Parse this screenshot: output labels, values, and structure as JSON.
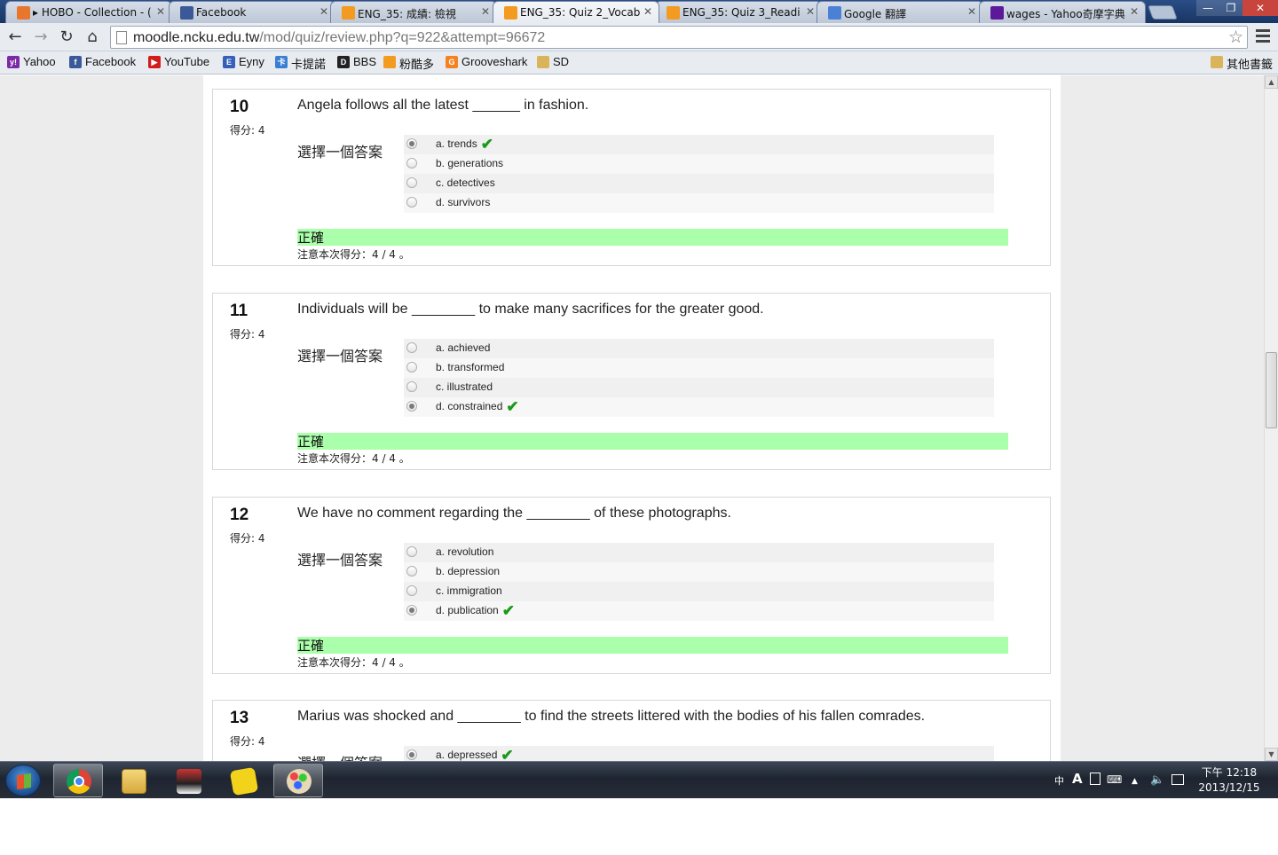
{
  "tabs": [
    {
      "label": "▸ HOBO - Collection - (",
      "favicon": "rss-icon",
      "color": "#e8772e"
    },
    {
      "label": "Facebook",
      "favicon": "facebook-icon",
      "color": "#3b5998"
    },
    {
      "label": "ENG_35: 成績: 檢視",
      "favicon": "moodle-icon",
      "color": "#f39a21"
    },
    {
      "label": "ENG_35: Quiz 2_Vocab",
      "favicon": "moodle-icon",
      "color": "#f39a21"
    },
    {
      "label": "ENG_35: Quiz 3_Readi",
      "favicon": "moodle-icon",
      "color": "#f39a21"
    },
    {
      "label": "Google 翻譯",
      "favicon": "google-translate-icon",
      "color": "#4a80d6"
    },
    {
      "label": "wages - Yahoo奇摩字典",
      "favicon": "yahoo-icon",
      "color": "#5c1a9a"
    }
  ],
  "window_controls": {
    "minimize": "—",
    "restore": "❐",
    "close": "✕"
  },
  "toolbar": {
    "url_host": "moodle.ncku.edu.tw",
    "url_path": "/mod/quiz/review.php?q=922&attempt=96672",
    "back": "←",
    "forward": "→",
    "reload": "↻",
    "home": "⌂",
    "star": "☆"
  },
  "bookmarks": [
    {
      "label": "Yahoo",
      "color": "#7b2aa6",
      "glyph": "y!"
    },
    {
      "label": "Facebook",
      "color": "#3b5998",
      "glyph": "f"
    },
    {
      "label": "YouTube",
      "color": "#d21b1b",
      "glyph": "▶"
    },
    {
      "label": "Eyny",
      "color": "#3561b8",
      "glyph": "E"
    },
    {
      "label": "卡提諾",
      "color": "#3a7fd4",
      "glyph": "卡"
    },
    {
      "label": "BBS",
      "color": "#222222",
      "glyph": "D"
    },
    {
      "label": "粉酷多",
      "color": "#f39a21",
      "glyph": " "
    },
    {
      "label": "Grooveshark",
      "color": "#f58220",
      "glyph": "G"
    },
    {
      "label": "SD",
      "color": "#d9b45a",
      "glyph": " "
    }
  ],
  "bookmarks_other": "其他書籤",
  "questions": [
    {
      "number": "10",
      "grade": "得分: 4",
      "text": "Angela follows all the latest ______ in fashion.",
      "prompt": "選擇一個答案",
      "answers": [
        {
          "label": "a. trends",
          "selected": true,
          "correct": true
        },
        {
          "label": "b. generations",
          "selected": false,
          "correct": false
        },
        {
          "label": "c. detectives",
          "selected": false,
          "correct": false
        },
        {
          "label": "d. survivors",
          "selected": false,
          "correct": false
        }
      ],
      "feedback": "正確",
      "mark": "注意本次得分：4 / 4 。"
    },
    {
      "number": "11",
      "grade": "得分: 4",
      "text": "Individuals will be ________ to make many sacrifices for the greater good.",
      "prompt": "選擇一個答案",
      "answers": [
        {
          "label": "a. achieved",
          "selected": false,
          "correct": false
        },
        {
          "label": "b. transformed",
          "selected": false,
          "correct": false
        },
        {
          "label": "c. illustrated",
          "selected": false,
          "correct": false
        },
        {
          "label": "d. constrained",
          "selected": true,
          "correct": true
        }
      ],
      "feedback": "正確",
      "mark": "注意本次得分：4 / 4 。"
    },
    {
      "number": "12",
      "grade": "得分: 4",
      "text": "We have no comment regarding the ________ of these photographs.",
      "prompt": "選擇一個答案",
      "answers": [
        {
          "label": "a. revolution",
          "selected": false,
          "correct": false
        },
        {
          "label": "b. depression",
          "selected": false,
          "correct": false
        },
        {
          "label": "c. immigration",
          "selected": false,
          "correct": false
        },
        {
          "label": "d. publication",
          "selected": true,
          "correct": true
        }
      ],
      "feedback": "正確",
      "mark": "注意本次得分：4 / 4 。"
    },
    {
      "number": "13",
      "grade": "得分: 4",
      "text": "Marius was shocked and ________ to find the streets littered with the bodies of his fallen comrades.",
      "prompt": "選擇一個答案",
      "answers": [
        {
          "label": "a. depressed",
          "selected": true,
          "correct": true
        }
      ],
      "feedback": "",
      "mark": ""
    }
  ],
  "taskbar": {
    "apps": [
      "start-button",
      "chrome-app",
      "explorer-app",
      "gundam-app",
      "media-app",
      "paint-app"
    ],
    "tray_icons": [
      "ime-icon",
      "A",
      "input-icon",
      "keyboard-icon",
      "▲",
      "volume-icon",
      "network-icon"
    ],
    "clock_time": "下午 12:18",
    "clock_date": "2013/12/15"
  },
  "colors": {
    "correct_bg": "#aaffaa",
    "tick": "#1a9a1a"
  }
}
